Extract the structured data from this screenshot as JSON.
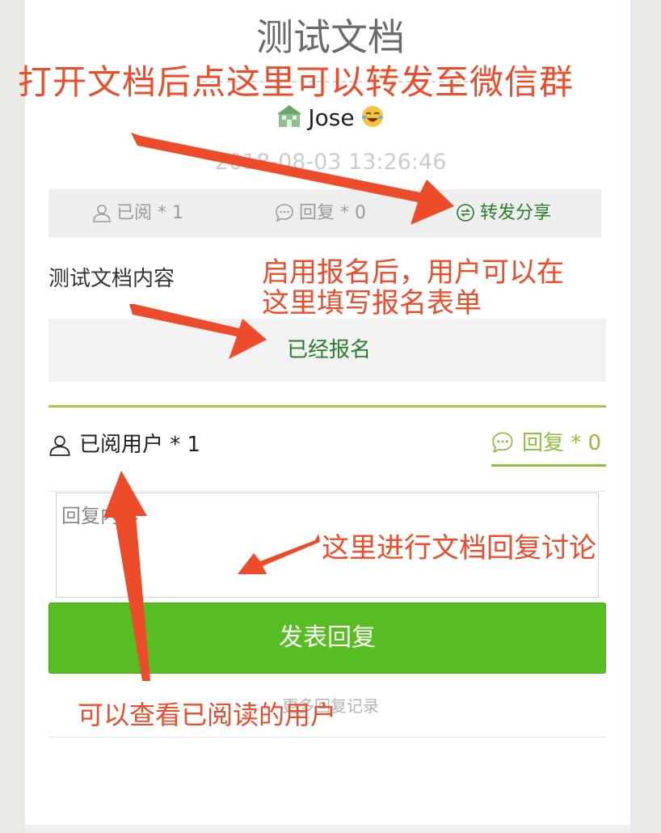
{
  "document": {
    "title": "测试文档",
    "author_name": "Jose",
    "timestamp": "2018-08-03 13:26:46",
    "content": "测试文档内容"
  },
  "stats": {
    "read_label": "已阅 * 1",
    "reply_label": "回复 * 0",
    "share_label": "转发分享"
  },
  "signup": {
    "status_label": "已经报名"
  },
  "tabs": {
    "readers_label": "已阅用户 * 1",
    "replies_label": "回复 * 0"
  },
  "reply_form": {
    "placeholder": "回复内容",
    "submit_label": "发表回复",
    "more_link": "更多回复记录"
  },
  "annotations": {
    "share_hint": "打开文档后点这里可以转发至微信群",
    "signup_hint_line1": "启用报名后，用户可以在",
    "signup_hint_line2": "这里填写报名表单",
    "reply_hint": "这里进行文档回复讨论",
    "readers_hint": "可以查看已阅读的用户"
  },
  "colors": {
    "accent_green": "#57bd23",
    "share_green": "#2a7d2a",
    "tab_green": "#8fbd3d",
    "annotation_red": "#ed4c2a"
  }
}
